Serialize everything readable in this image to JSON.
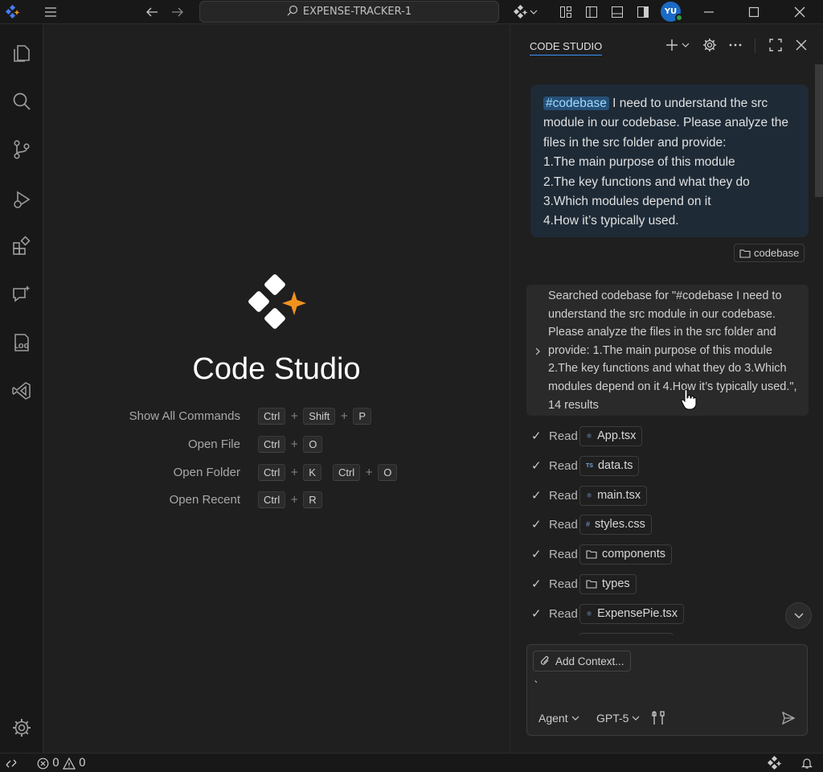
{
  "titlebar": {
    "search_text": "EXPENSE-TRACKER-1",
    "avatar_initials": "YU"
  },
  "welcome": {
    "title": "Code Studio",
    "shortcuts": [
      {
        "label": "Show All Commands",
        "keys": [
          "Ctrl",
          "Shift",
          "P"
        ]
      },
      {
        "label": "Open File",
        "keys": [
          "Ctrl",
          "O"
        ]
      },
      {
        "label": "Open Folder",
        "keys": [
          "Ctrl",
          "K"
        ],
        "keys2": [
          "Ctrl",
          "O"
        ]
      },
      {
        "label": "Open Recent",
        "keys": [
          "Ctrl",
          "R"
        ]
      }
    ],
    "plus": "+"
  },
  "panel": {
    "title": "CODE STUDIO",
    "user_message": {
      "tag": "#codebase",
      "text_after_tag": "I need to understand the src module in our codebase. Please analyze the files in the src folder and provide:",
      "lines": [
        "1.The main purpose of this module",
        "2.The key functions and what they do",
        "3.Which modules depend on it",
        "4.How it’s typically used."
      ],
      "context_chip": "codebase"
    },
    "search_result": "Searched codebase for \"#codebase I need to understand the src module in our codebase. Please analyze the files in the src folder and provide: 1.The main purpose of this module 2.The key functions and what they do 3.Which modules depend on it 4.How it’s typically used.\", 14 results",
    "read_label": "Read",
    "reads": [
      {
        "name": "App.tsx",
        "icon": "react-icon"
      },
      {
        "name": "data.ts",
        "icon": "ts-icon"
      },
      {
        "name": "main.tsx",
        "icon": "react-icon"
      },
      {
        "name": "styles.css",
        "icon": "css-icon"
      },
      {
        "name": "components",
        "icon": "folder-icon"
      },
      {
        "name": "types",
        "icon": "folder-icon"
      },
      {
        "name": "ExpensePie.tsx",
        "icon": "react-icon"
      }
    ],
    "input": {
      "add_context": "Add Context...",
      "value": "`",
      "mode": "Agent",
      "model": "GPT-5"
    }
  },
  "statusbar": {
    "errors": "0",
    "warnings": "0"
  },
  "colors": {
    "accent": "#3794ff",
    "logo_star": "#f0931e",
    "avatar": "#1b6ac6"
  }
}
